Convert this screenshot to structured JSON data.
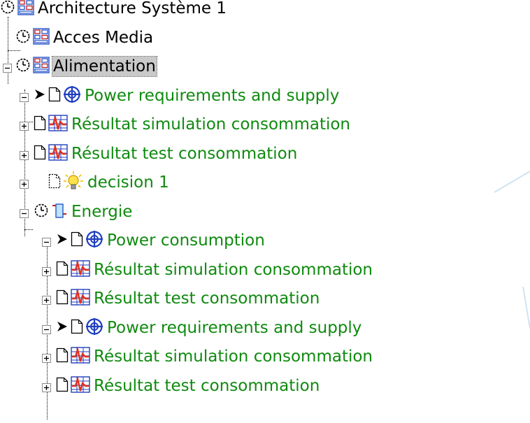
{
  "colors": {
    "system_text": "#000000",
    "item_text": "#0f8a0f",
    "requirement_icon": "#1f3fbf",
    "result_icon": "#e0301e",
    "selection": "#c9c9c9"
  },
  "tree": [
    {
      "level": 0,
      "label": "Architecture Système 1",
      "icon": "architecture-block-icon",
      "status_icon": "clock-icon",
      "style": "system",
      "expander": null
    },
    {
      "level": 1,
      "label": "Acces Media",
      "icon": "architecture-block-icon",
      "status_icon": "clock-icon",
      "style": "system",
      "expander": null
    },
    {
      "level": 1,
      "label": "Alimentation",
      "icon": "architecture-block-icon",
      "status_icon": "clock-icon",
      "style": "system",
      "expander": "minus",
      "selected": true
    },
    {
      "level": 2,
      "label": "Power requirements and supply",
      "icon": "requirement-target-icon",
      "arrow": true,
      "doc": "solid",
      "style": "item",
      "expander": "minus"
    },
    {
      "level": 2,
      "label": "Résultat simulation consommation",
      "icon": "result-chart-icon",
      "doc": "solid",
      "style": "item",
      "expander": "plus"
    },
    {
      "level": 2,
      "label": "Résultat test consommation",
      "icon": "result-chart-icon",
      "doc": "solid",
      "style": "item",
      "expander": "plus"
    },
    {
      "level": 2,
      "label": "decision 1",
      "icon": "lightbulb-icon",
      "doc": "dashed",
      "style": "item",
      "expander": "plus",
      "gap": true
    },
    {
      "level": 2,
      "label": "Energie",
      "icon": "component-block-icon",
      "status_icon": "clock-icon",
      "style": "item",
      "expander": "minus"
    },
    {
      "level": 3,
      "label": "Power consumption",
      "icon": "requirement-target-icon",
      "arrow": true,
      "doc": "solid",
      "style": "item",
      "expander": "minus",
      "gap": true
    },
    {
      "level": 3,
      "label": "Résultat simulation consommation",
      "icon": "result-chart-icon",
      "doc": "solid",
      "style": "item",
      "expander": "plus"
    },
    {
      "level": 3,
      "label": "Résultat test consommation",
      "icon": "result-chart-icon",
      "doc": "solid",
      "style": "item",
      "expander": "plus"
    },
    {
      "level": 3,
      "label": "Power requirements and supply",
      "icon": "requirement-target-icon",
      "arrow": true,
      "doc": "solid",
      "style": "item",
      "expander": "minus",
      "gap": true
    },
    {
      "level": 3,
      "label": "Résultat simulation consommation",
      "icon": "result-chart-icon",
      "doc": "solid",
      "style": "item",
      "expander": "plus"
    },
    {
      "level": 3,
      "label": "Résultat test consommation",
      "icon": "result-chart-icon",
      "doc": "solid",
      "style": "item",
      "expander": "plus"
    }
  ]
}
